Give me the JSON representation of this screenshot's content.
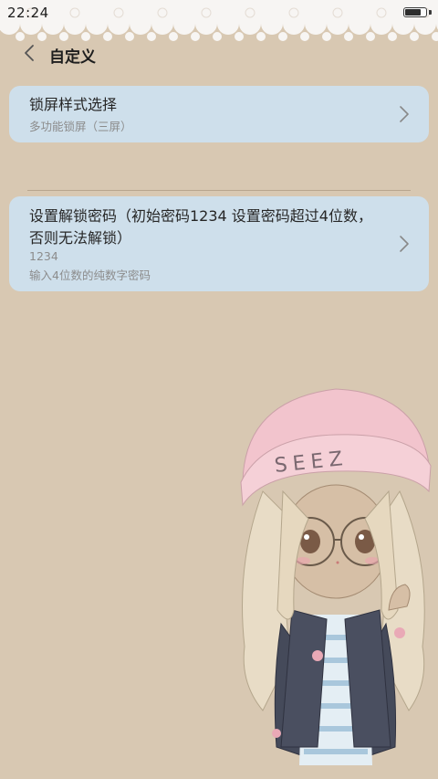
{
  "status_bar": {
    "time": "22:24",
    "battery_level": 0.72
  },
  "header": {
    "back_icon": "chevron-left-icon",
    "title": "自定义"
  },
  "settings": [
    {
      "title": "锁屏样式选择",
      "subtitle": "多功能锁屏（三屏）",
      "icon": "chevron-right-icon"
    },
    {
      "title": "设置解锁密码（初始密码1234  设置密码超过4位数，否则无法解锁）",
      "value": "1234",
      "subtitle": "输入4位数的纯数字密码",
      "icon": "chevron-right-icon"
    }
  ],
  "illustration": {
    "hat_text": "SEEZ"
  },
  "colors": {
    "background": "#d8c8b2",
    "card": "#cde1f0",
    "hat": "#f2c4cd"
  }
}
